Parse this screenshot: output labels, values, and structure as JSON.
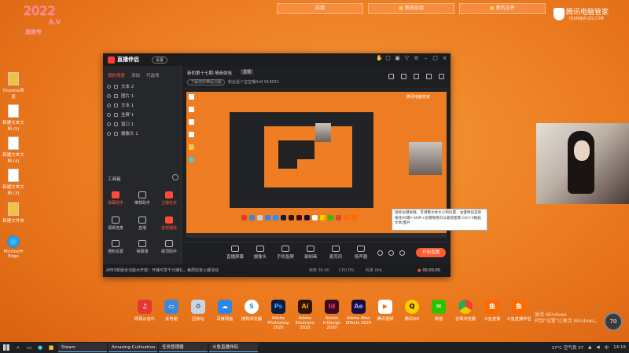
{
  "top_tabs": [
    {
      "label": "应用",
      "icon": ""
    },
    {
      "label": "新的应用",
      "icon": "folder-icon"
    },
    {
      "label": "新的文件",
      "icon": "folder-icon"
    }
  ],
  "tencent": {
    "name": "腾讯电脑管家",
    "url": "QUANJIA.QQ.COM"
  },
  "pink_overlay": {
    "line1": "2022",
    "line2": "A.V",
    "line3": "周周号"
  },
  "desktop_icons": [
    {
      "label": "Chrome浏览",
      "kind": "yellow"
    },
    {
      "label": "新建文本文档 (5)",
      "kind": "doc"
    },
    {
      "label": "新建文本文档 (4)",
      "kind": "doc"
    },
    {
      "label": "新建文本文档 (3)",
      "kind": "doc"
    },
    {
      "label": "新建文件夹",
      "kind": "yellow"
    },
    {
      "label": "Microsoft Edge",
      "kind": "edge"
    }
  ],
  "app": {
    "name": "直播伴侣",
    "version": "设置",
    "side_tabs": [
      "我的场景",
      "添加",
      "可选项"
    ],
    "layers": [
      "文本 2",
      "图片 1",
      "文本 1",
      "全屏 1",
      "窗口 1",
      "摄像头 1"
    ],
    "toolbox_title": "工具箱",
    "tools": [
      {
        "label": "弹幕助手",
        "red": true
      },
      {
        "label": "推荐助手",
        "red": false
      },
      {
        "label": "主播任务",
        "red": true
      },
      {
        "label": "视频连麦",
        "red": true
      },
      {
        "label": "直播",
        "red": false
      },
      {
        "label": "音频播放",
        "red": true
      },
      {
        "label": "通知设置",
        "red": false
      },
      {
        "label": "弹幕墙",
        "red": false
      },
      {
        "label": "歌词助手",
        "red": false
      }
    ],
    "room": {
      "title": "新的第十七期-情商体验",
      "tag": "直播",
      "sub_pill": "了解您的带起功能",
      "sub_text": "粉丝是个宝宝哦0v0  914031"
    },
    "tooltip": "鼠标左键拖拽，可调整文本大小和位置，右键弹出菜单\n按住Alt键+Shift+左键拖拽可以裁剪图像\nCtrl+V粘贴文本/图片",
    "preview_badge": "腾讯电脑管家",
    "controls": [
      {
        "label": "直播屏幕"
      },
      {
        "label": "摄像头"
      },
      {
        "label": "手机投屏"
      },
      {
        "label": "录制画"
      },
      {
        "label": "麦克风"
      },
      {
        "label": "扬声器"
      }
    ],
    "start_label": "开始直播",
    "status": {
      "notice": "APEX新版全功能大开放！开播可享千元壕礼，每周还有火爆活动",
      "s1": "帧率 30.00",
      "s2": "CPU 0%",
      "s3": "码率 0kb",
      "time": "00:00:00"
    }
  },
  "dock": [
    {
      "label": "网易云音乐",
      "color": "#e3382f",
      "glyph": "♫"
    },
    {
      "label": "此电脑",
      "color": "#3d87d8",
      "glyph": "▭"
    },
    {
      "label": "回收站",
      "color": "#c9d6e2",
      "glyph": "♻"
    },
    {
      "label": "百度网盘",
      "color": "#2d87e8",
      "glyph": "☁"
    },
    {
      "label": "搜狗浏览器",
      "color": "#1e90ff",
      "glyph": "S"
    },
    {
      "label": "Adobe Photoshop 2020",
      "color": "#0a1d3d",
      "glyph": "Ps"
    },
    {
      "label": "Adobe Illustrator 2020",
      "color": "#2d1400",
      "glyph": "Ai"
    },
    {
      "label": "Adobe InDesign 2020",
      "color": "#3c0a22",
      "glyph": "Id"
    },
    {
      "label": "Adobe After Effects 2020",
      "color": "#1a0b3d",
      "glyph": "Ae"
    },
    {
      "label": "腾讯视频",
      "color": "#ffffff",
      "glyph": "▶"
    },
    {
      "label": "腾讯QQ",
      "color": "#ffcc00",
      "glyph": "Q"
    },
    {
      "label": "微信",
      "color": "#2dc100",
      "glyph": "✉"
    },
    {
      "label": "谷歌浏览器",
      "color": "#e84133",
      "glyph": "◉"
    },
    {
      "label": "斗鱼直播",
      "color": "#ff6a00",
      "glyph": "鱼"
    },
    {
      "label": "斗鱼直播伴侣",
      "color": "#ff6a00",
      "glyph": "鱼"
    }
  ],
  "activate": {
    "line1": "激活 Windows",
    "line2": "转到\"设置\"以激活 Windows。"
  },
  "temp": "70",
  "taskbar": {
    "apps": [
      "Steam",
      "Amazing Cultivation...",
      "任务管理器",
      "斗鱼直播伴侣"
    ],
    "weather": "17°C  空气良 37",
    "lang": "中",
    "time": "14:16"
  }
}
